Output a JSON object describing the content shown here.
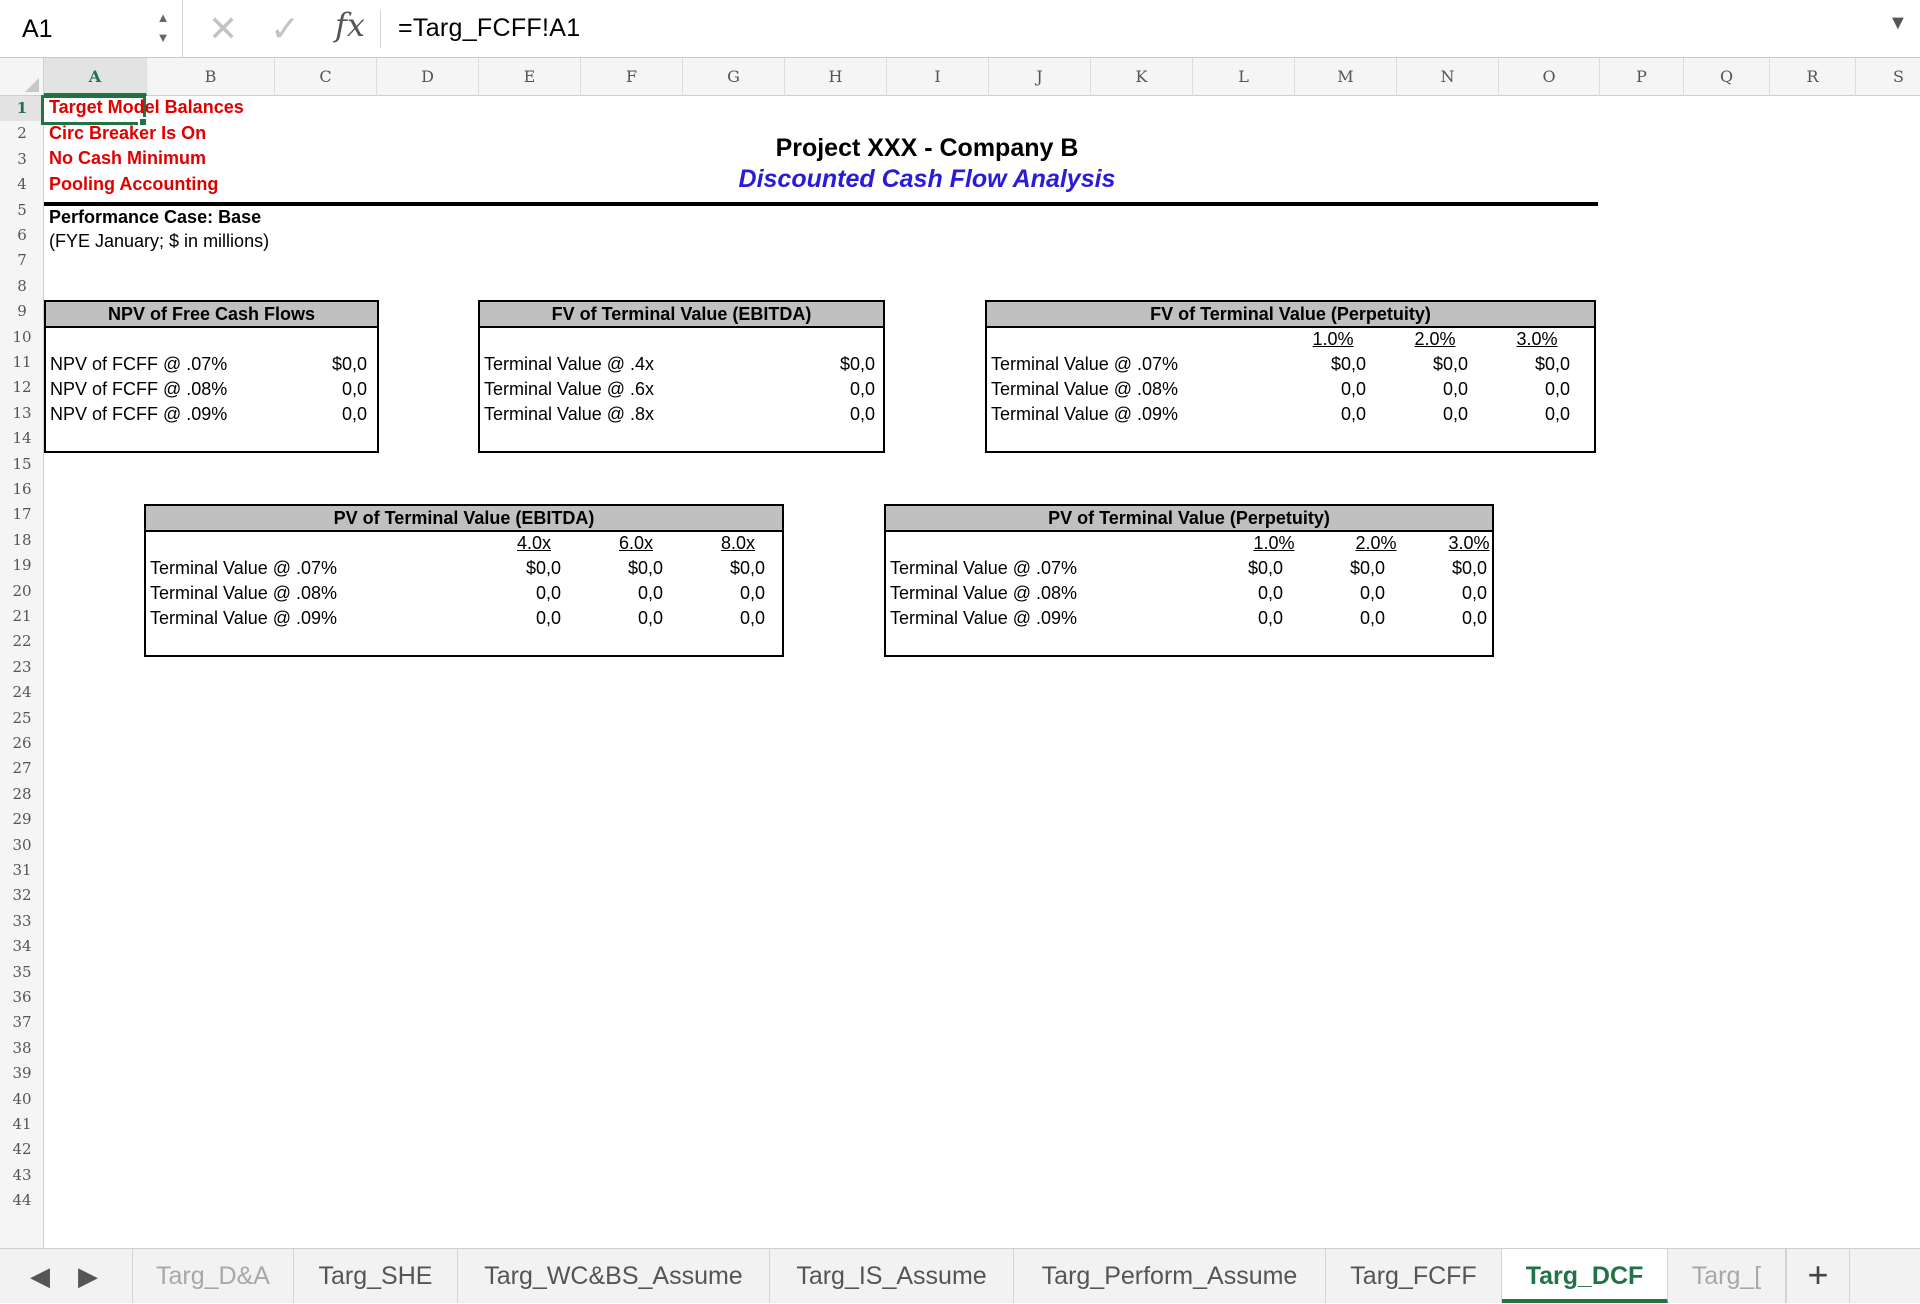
{
  "formula_bar": {
    "name_box": "A1",
    "fx_label": "fx",
    "formula": "=Targ_FCFF!A1"
  },
  "columns": [
    "A",
    "B",
    "C",
    "D",
    "E",
    "F",
    "G",
    "H",
    "I",
    "J",
    "K",
    "L",
    "M",
    "N",
    "O",
    "P",
    "Q",
    "R",
    "S"
  ],
  "rows": [
    "1",
    "2",
    "3",
    "4",
    "5",
    "6",
    "7",
    "8",
    "9",
    "10",
    "11",
    "12",
    "13",
    "14",
    "15",
    "16",
    "17",
    "18",
    "19",
    "20",
    "21",
    "22",
    "23",
    "24",
    "25",
    "26",
    "27",
    "28",
    "29",
    "30",
    "31",
    "32",
    "33",
    "34",
    "35",
    "36",
    "37",
    "38",
    "39",
    "40",
    "41",
    "42",
    "43",
    "44"
  ],
  "flags": [
    "Target Model Balances",
    "Circ Breaker Is On",
    "No Cash Minimum",
    "Pooling Accounting"
  ],
  "title": "Project XXX - Company B",
  "subtitle": "Discounted Cash Flow Analysis",
  "case_label": "Performance Case: Base",
  "units_note": "(FYE January; $ in millions)",
  "npv_box": {
    "header": "NPV of Free Cash Flows",
    "rows": [
      {
        "label": "NPV of FCFF @ .07%",
        "value": "$0,0"
      },
      {
        "label": "NPV of FCFF @ .08%",
        "value": "0,0"
      },
      {
        "label": "NPV of FCFF @ .09%",
        "value": "0,0"
      }
    ]
  },
  "fv_ebitda_box": {
    "header": "FV of Terminal Value (EBITDA)",
    "rows": [
      {
        "label": "Terminal Value @ .4x",
        "value": "$0,0"
      },
      {
        "label": "Terminal Value @ .6x",
        "value": "0,0"
      },
      {
        "label": "Terminal Value @ .8x",
        "value": "0,0"
      }
    ]
  },
  "fv_perp_box": {
    "header": "FV of Terminal Value (Perpetuity)",
    "col_headers": [
      "1.0%",
      "2.0%",
      "3.0%"
    ],
    "rows": [
      {
        "label": "Terminal Value @ .07%",
        "values": [
          "$0,0",
          "$0,0",
          "$0,0"
        ]
      },
      {
        "label": "Terminal Value @ .08%",
        "values": [
          "0,0",
          "0,0",
          "0,0"
        ]
      },
      {
        "label": "Terminal Value @ .09%",
        "values": [
          "0,0",
          "0,0",
          "0,0"
        ]
      }
    ]
  },
  "pv_ebitda_box": {
    "header": "PV of Terminal Value (EBITDA)",
    "col_headers": [
      "4.0x",
      "6.0x",
      "8.0x"
    ],
    "rows": [
      {
        "label": "Terminal Value @ .07%",
        "values": [
          "$0,0",
          "$0,0",
          "$0,0"
        ]
      },
      {
        "label": "Terminal Value @ .08%",
        "values": [
          "0,0",
          "0,0",
          "0,0"
        ]
      },
      {
        "label": "Terminal Value @ .09%",
        "values": [
          "0,0",
          "0,0",
          "0,0"
        ]
      }
    ]
  },
  "pv_perp_box": {
    "header": "PV of Terminal Value (Perpetuity)",
    "col_headers": [
      "1.0%",
      "2.0%",
      "3.0%"
    ],
    "rows": [
      {
        "label": "Terminal Value @ .07%",
        "values": [
          "$0,0",
          "$0,0",
          "$0,0"
        ]
      },
      {
        "label": "Terminal Value @ .08%",
        "values": [
          "0,0",
          "0,0",
          "0,0"
        ]
      },
      {
        "label": "Terminal Value @ .09%",
        "values": [
          "0,0",
          "0,0",
          "0,0"
        ]
      }
    ]
  },
  "tabs": {
    "prev_icon": "◀",
    "next_icon": "▶",
    "add_label": "+",
    "items": [
      "Targ_D&A",
      "Targ_SHE",
      "Targ_WC&BS_Assume",
      "Targ_IS_Assume",
      "Targ_Perform_Assume",
      "Targ_FCFF",
      "Targ_DCF",
      "Targ_["
    ],
    "active": "Targ_DCF"
  },
  "colors": {
    "accent": "#217346",
    "flag_red": "#e00000",
    "subtitle_blue": "#2a1bd8",
    "header_gray": "#c0c0c0"
  }
}
